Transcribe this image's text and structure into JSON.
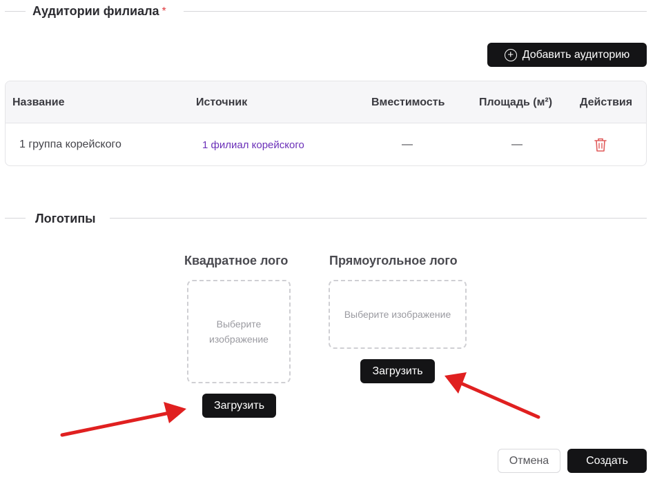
{
  "classrooms_section": {
    "title": "Аудитории филиала",
    "required_mark": "*",
    "add_button_label": "Добавить аудиторию"
  },
  "table": {
    "headers": {
      "name": "Название",
      "source": "Источник",
      "capacity": "Вместимость",
      "area": "Площадь (м²)",
      "actions": "Действия"
    },
    "rows": [
      {
        "name": "1 группа корейского",
        "source": "1 филиал корейского",
        "capacity": "—",
        "area": "—",
        "action_icon": "trash-icon"
      }
    ]
  },
  "logos_section": {
    "title": "Логотипы",
    "square": {
      "label": "Квадратное лого",
      "placeholder": "Выберите изображение",
      "upload_label": "Загрузить"
    },
    "rectangular": {
      "label": "Прямоугольное лого",
      "placeholder": "Выберите изображение",
      "upload_label": "Загрузить"
    }
  },
  "footer": {
    "cancel_label": "Отмена",
    "create_label": "Создать"
  },
  "colors": {
    "accent_dark": "#141416",
    "required": "#e0393e",
    "link": "#6a2fb8",
    "delete": "#e0393e",
    "annotation_arrow": "#e02020"
  }
}
